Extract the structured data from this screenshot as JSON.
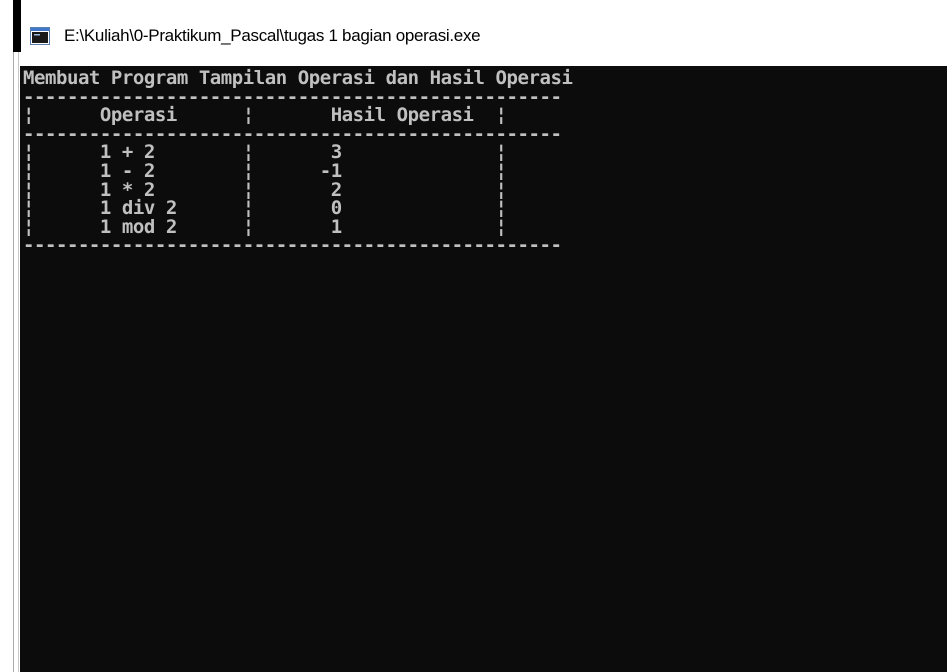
{
  "window": {
    "title": "E:\\Kuliah\\0-Praktikum_Pascal\\tugas 1 bagian operasi.exe"
  },
  "console": {
    "lines": [
      "Membuat Program Tampilan Operasi dan Hasil Operasi",
      "-------------------------------------------------",
      "¦      Operasi      ¦       Hasil Operasi  ¦",
      "-------------------------------------------------",
      "¦      1 + 2        ¦       3              ¦",
      "¦      1 - 2        ¦      -1              ¦",
      "¦      1 * 2        ¦       2              ¦",
      "¦      1 div 2      ¦       0              ¦",
      "¦      1 mod 2      ¦       1              ¦",
      "-------------------------------------------------"
    ]
  }
}
